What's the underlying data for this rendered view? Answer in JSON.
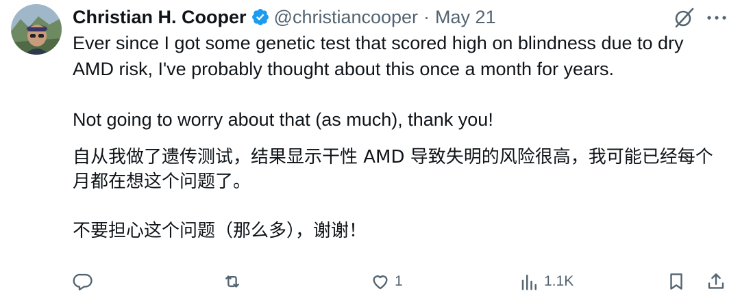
{
  "tweet": {
    "author_name": "Christian H. Cooper",
    "handle": "@christiancooper",
    "separator": "·",
    "date": "May 21",
    "verified": true,
    "paragraphs": [
      "Ever since I got some genetic test that scored high on blindness due to dry AMD risk, I've probably thought about this once a month for years.",
      "Not going to worry about that (as much), thank you!"
    ],
    "translation": [
      "自从我做了遗传测试，结果显示干性 AMD 导致失明的风险很高，我可能已经每个月都在想这个问题了。",
      "不要担心这个问题（那么多），谢谢！"
    ]
  },
  "actions": {
    "reply_count": "",
    "retweet_count": "",
    "like_count": "1",
    "views_count": "1.1K"
  },
  "icons": {
    "verified": "verified-badge-icon",
    "grok": "grok-icon",
    "more": "more-icon",
    "reply": "reply-icon",
    "retweet": "retweet-icon",
    "like": "heart-icon",
    "views": "views-icon",
    "bookmark": "bookmark-icon",
    "share": "share-icon"
  },
  "colors": {
    "text": "#0f1419",
    "secondary": "#536471",
    "verified": "#1d9bf0"
  }
}
